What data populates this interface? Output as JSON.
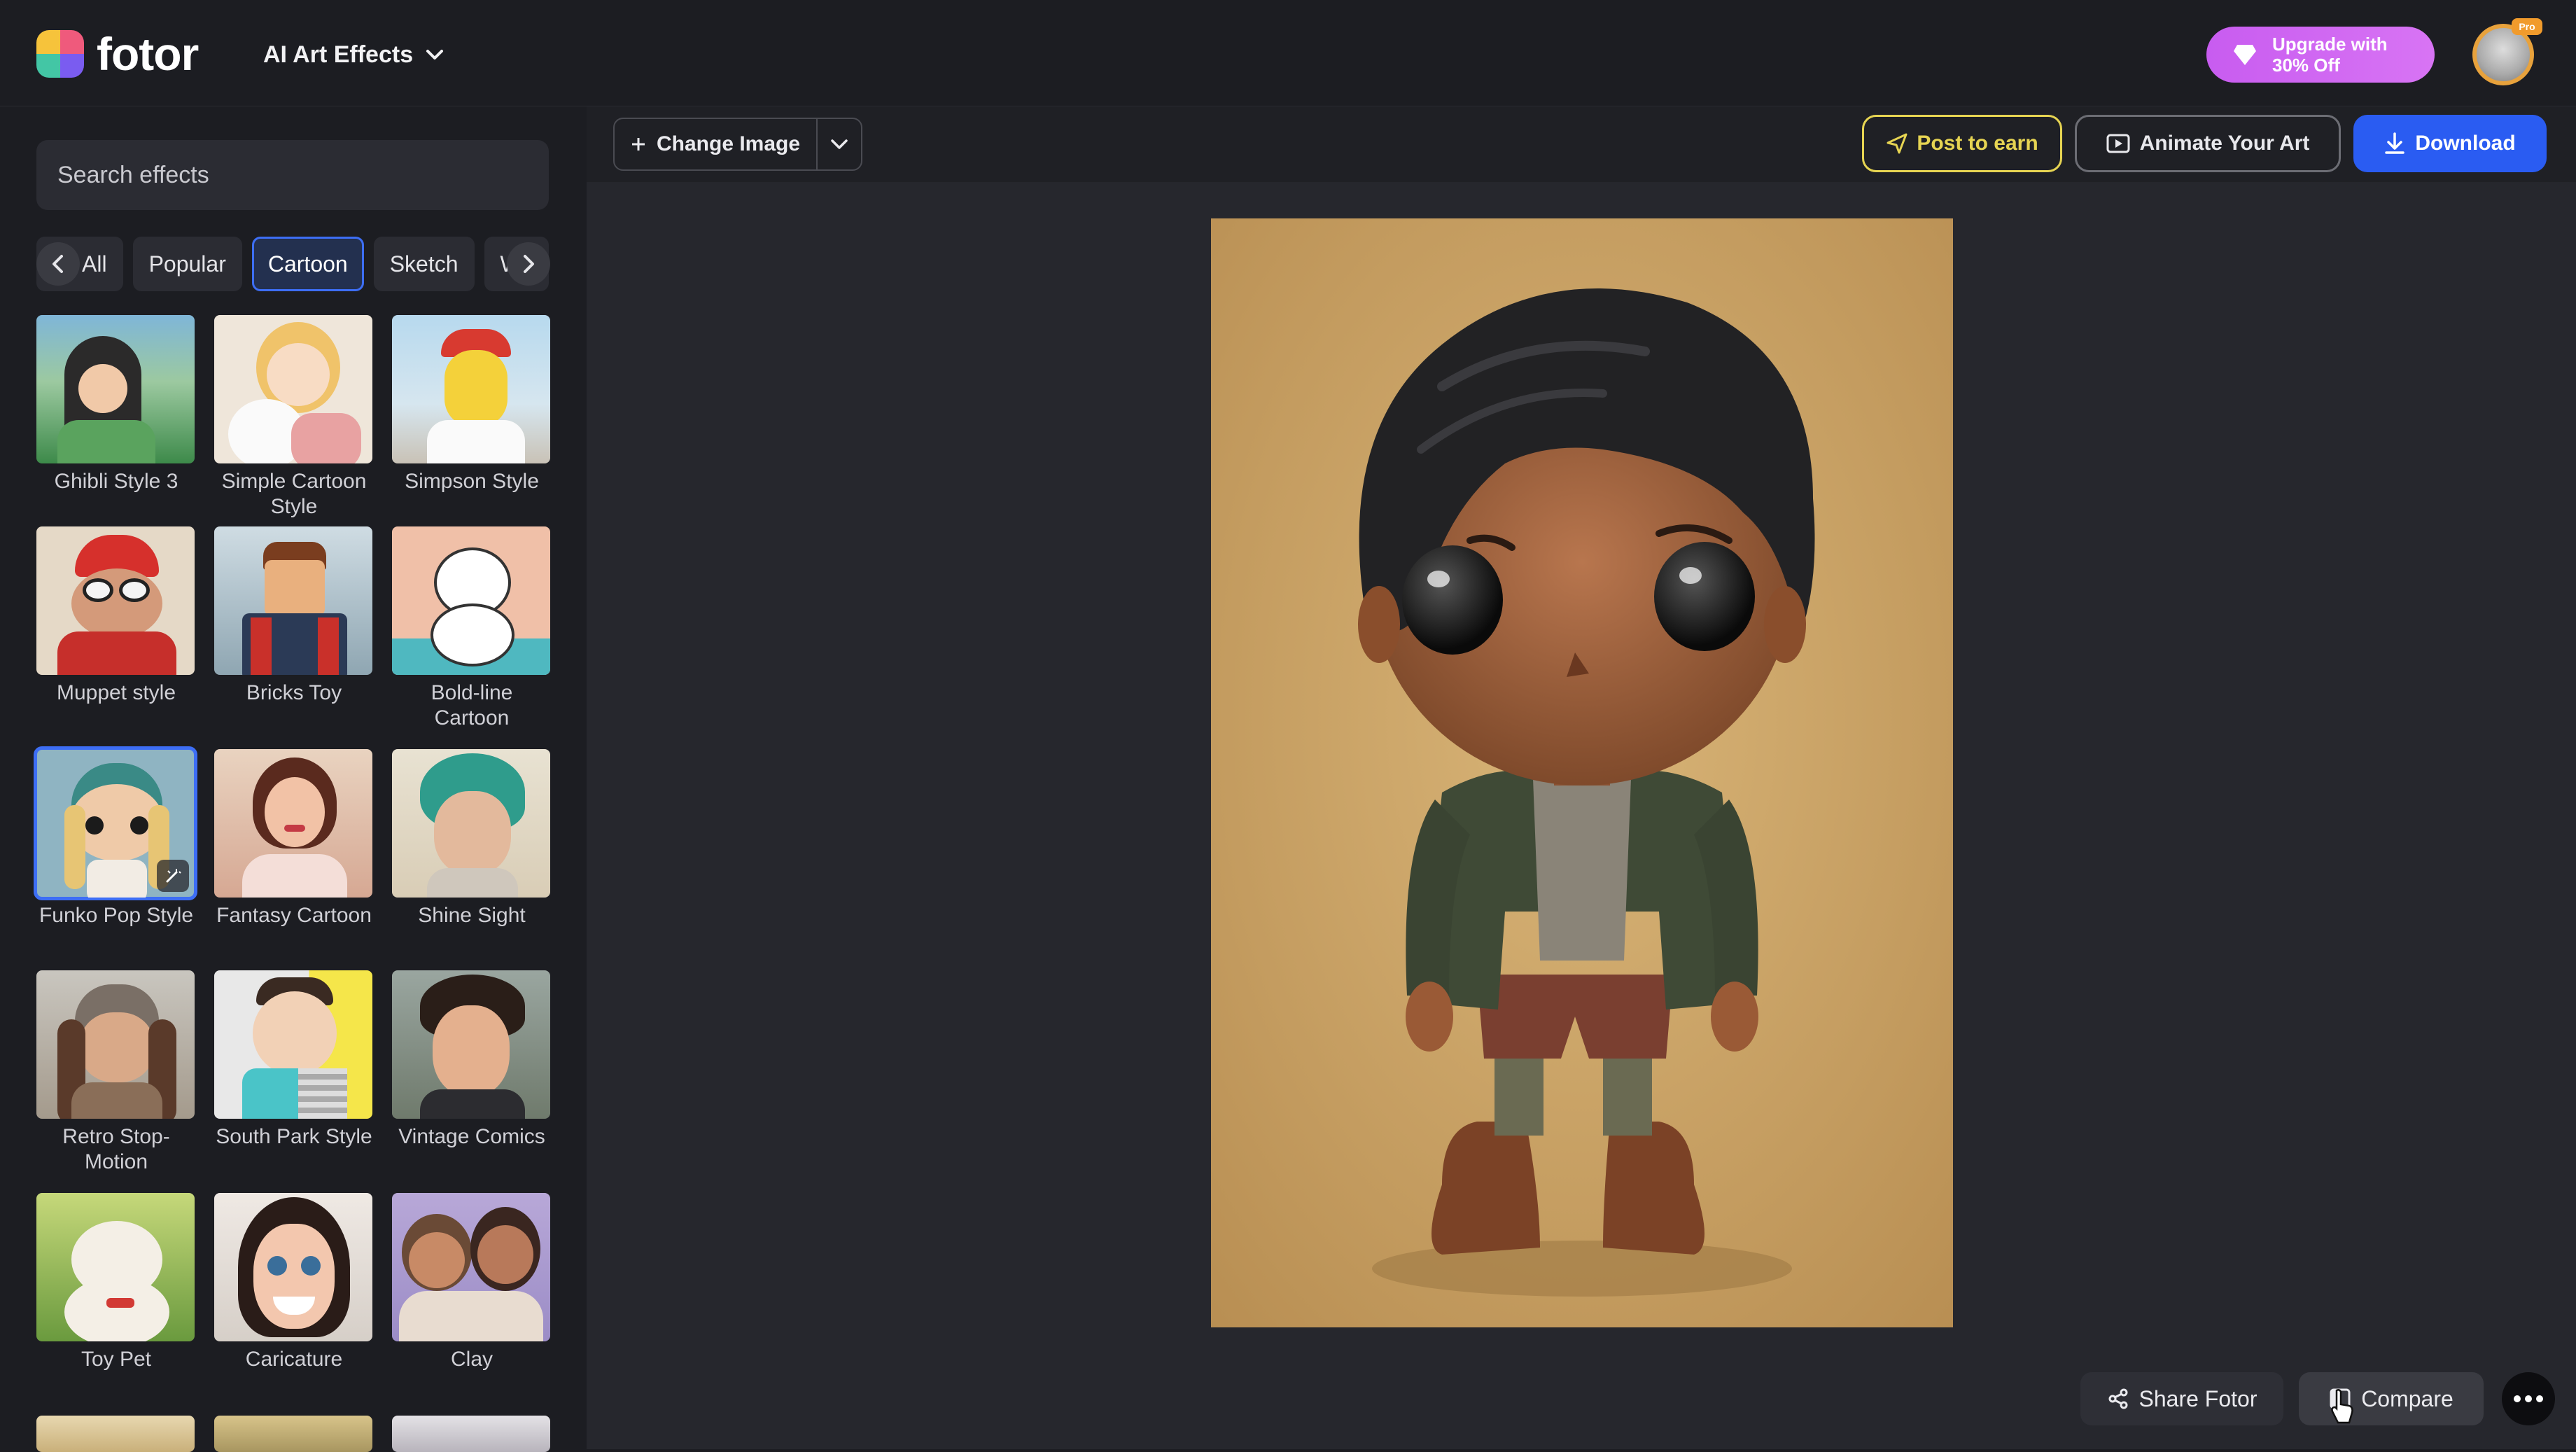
{
  "app": {
    "logo_text": "fotor",
    "menu_label": "AI Art Effects",
    "upgrade_label": "Upgrade with\n30% Off",
    "pro_badge": "Pro"
  },
  "sidebar": {
    "search_placeholder": "Search effects",
    "categories": [
      "All",
      "Popular",
      "Cartoon",
      "Sketch",
      "Wa"
    ],
    "active_category": "Cartoon",
    "effects": [
      {
        "label": "Ghibli Style 3"
      },
      {
        "label": "Simple Cartoon Style"
      },
      {
        "label": "Simpson Style"
      },
      {
        "label": "Muppet style"
      },
      {
        "label": "Bricks Toy"
      },
      {
        "label": "Bold-line Cartoon"
      },
      {
        "label": "Funko Pop Style"
      },
      {
        "label": "Fantasy Cartoon"
      },
      {
        "label": "Shine Sight"
      },
      {
        "label": "Retro Stop-Motion"
      },
      {
        "label": "South Park Style"
      },
      {
        "label": "Vintage Comics"
      },
      {
        "label": "Toy Pet"
      },
      {
        "label": "Caricature"
      },
      {
        "label": "Clay"
      }
    ],
    "selected_effect": "Funko Pop Style"
  },
  "toolbar": {
    "change_image": "Change Image",
    "post_to_earn": "Post to earn",
    "animate": "Animate Your Art",
    "download": "Download"
  },
  "footer": {
    "share": "Share Fotor",
    "compare": "Compare"
  },
  "colors": {
    "accent": "#2a5cf2",
    "upgrade": "#d06cf2",
    "post_to_earn": "#e6d452"
  }
}
